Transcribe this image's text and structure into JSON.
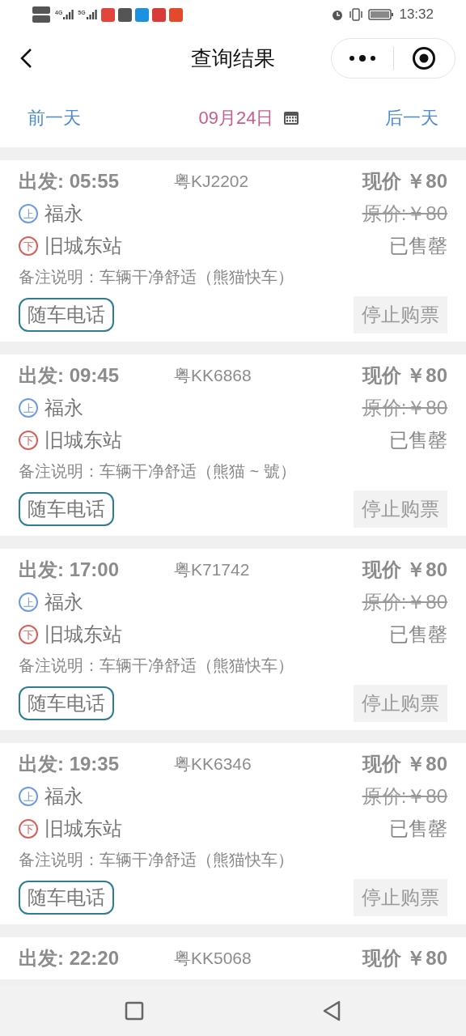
{
  "status_bar": {
    "networks": [
      "4G",
      "5G"
    ],
    "time": "13:32"
  },
  "header": {
    "title": "查询结果"
  },
  "date_bar": {
    "prev": "前一天",
    "date": "09月24日",
    "next": "后一天"
  },
  "trips": [
    {
      "departure": "出发: 05:55",
      "plate": "粤KJ2202",
      "price": "现价 ￥80",
      "from_badge": "上",
      "from": "福永",
      "original_price": "原价:￥80",
      "to_badge": "下",
      "to": "旧城东站",
      "status": "已售罄",
      "remark": "备注说明：车辆干净舒适（熊猫快车）",
      "phone_button": "随车电话",
      "buy_button": "停止购票",
      "buy_disabled": true
    },
    {
      "departure": "出发: 09:45",
      "plate": "粤KK6868",
      "price": "现价 ￥80",
      "from_badge": "上",
      "from": "福永",
      "original_price": "原价:￥80",
      "to_badge": "下",
      "to": "旧城东站",
      "status": "已售罄",
      "remark": "备注说明：车辆干净舒适（熊猫 ~ 號）",
      "phone_button": "随车电话",
      "buy_button": "停止购票",
      "buy_disabled": true
    },
    {
      "departure": "出发: 17:00",
      "plate": "粤K71742",
      "price": "现价 ￥80",
      "from_badge": "上",
      "from": "福永",
      "original_price": "原价:￥80",
      "to_badge": "下",
      "to": "旧城东站",
      "status": "已售罄",
      "remark": "备注说明：车辆干净舒适（熊猫快车）",
      "phone_button": "随车电话",
      "buy_button": "停止购票",
      "buy_disabled": true
    },
    {
      "departure": "出发: 19:35",
      "plate": "粤KK6346",
      "price": "现价 ￥80",
      "from_badge": "上",
      "from": "福永",
      "original_price": "原价:￥80",
      "to_badge": "下",
      "to": "旧城东站",
      "status": "已售罄",
      "remark": "备注说明：车辆干净舒适（熊猫快车）",
      "phone_button": "随车电话",
      "buy_button": "停止购票",
      "buy_disabled": true
    },
    {
      "departure": "出发: 22:20",
      "plate": "粤KK5068",
      "price": "现价 ￥80"
    }
  ]
}
